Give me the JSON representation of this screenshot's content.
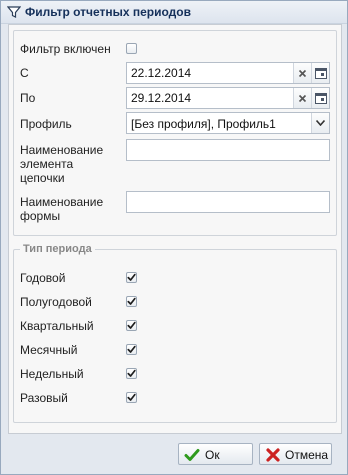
{
  "window": {
    "title": "Фильтр отчетных периодов"
  },
  "filter": {
    "enabled_label": "Фильтр включен",
    "enabled_checked": false,
    "from_label": "С",
    "from_value": "22.12.2014",
    "to_label": "По",
    "to_value": "29.12.2014",
    "profile_label": "Профиль",
    "profile_value": "[Без профиля], Профиль1",
    "chain_label_line1": "Наименование",
    "chain_label_line2": "элемента",
    "chain_label_line3": "цепочки",
    "chain_value": "",
    "form_label_line1": "Наименование",
    "form_label_line2": "формы",
    "form_value": ""
  },
  "period_types": {
    "legend": "Тип периода",
    "items": [
      {
        "label": "Годовой",
        "checked": true
      },
      {
        "label": "Полугодовой",
        "checked": true
      },
      {
        "label": "Квартальный",
        "checked": true
      },
      {
        "label": "Месячный",
        "checked": true
      },
      {
        "label": "Недельный",
        "checked": true
      },
      {
        "label": "Разовый",
        "checked": true
      }
    ]
  },
  "footer": {
    "ok_label": "Ок",
    "cancel_label": "Отмена"
  },
  "colors": {
    "ok_icon": "#2e9a1c",
    "cancel_icon": "#cc2222",
    "title": "#15305a"
  }
}
